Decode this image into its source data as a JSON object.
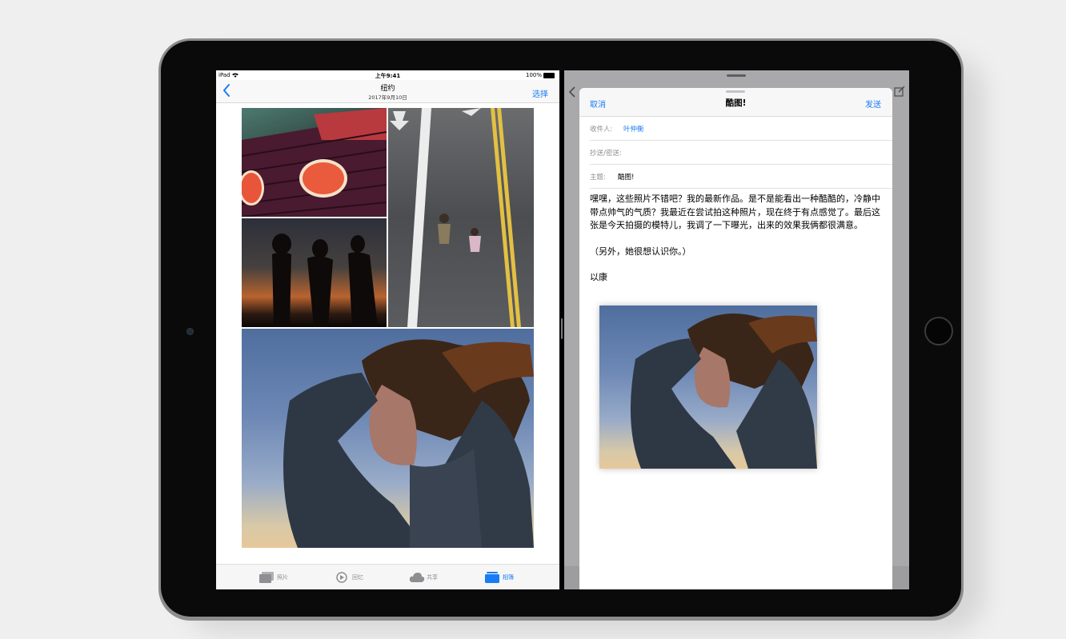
{
  "status_bar": {
    "carrier": "iPad",
    "time": "上午9:41",
    "battery": "100%"
  },
  "photos": {
    "nav": {
      "title": "纽约",
      "subtitle": "2017年9月10日",
      "select_label": "选择"
    },
    "tabs": [
      {
        "label": "照片",
        "icon": "photos-icon",
        "active": false
      },
      {
        "label": "回忆",
        "icon": "memories-icon",
        "active": false
      },
      {
        "label": "共享",
        "icon": "cloud-icon",
        "active": false
      },
      {
        "label": "相簿",
        "icon": "albums-icon",
        "active": true
      }
    ]
  },
  "compose": {
    "cancel_label": "取消",
    "title": "酷图!",
    "send_label": "发送",
    "to_label": "收件人:",
    "to_value": "叶仲衡",
    "cc_label": "抄送/密送:",
    "subject_label": "主题:",
    "subject_value": "酷图!",
    "body": [
      "嘿嘿，这些照片不错吧？我的最新作品。是不是能看出一种酷酷的，冷静中带点帅气的气质？我最近在尝试拍这种照片，现在终于有点感觉了。最后这张是今天拍摄的模特儿，我调了一下曝光，出来的效果我俩都很满意。",
      "（另外，她很想认识你。）",
      "以康"
    ]
  },
  "colors": {
    "accent": "#1a7cf5",
    "secondary_text": "#8e8e93",
    "device_frame": "#0a0a0a"
  }
}
